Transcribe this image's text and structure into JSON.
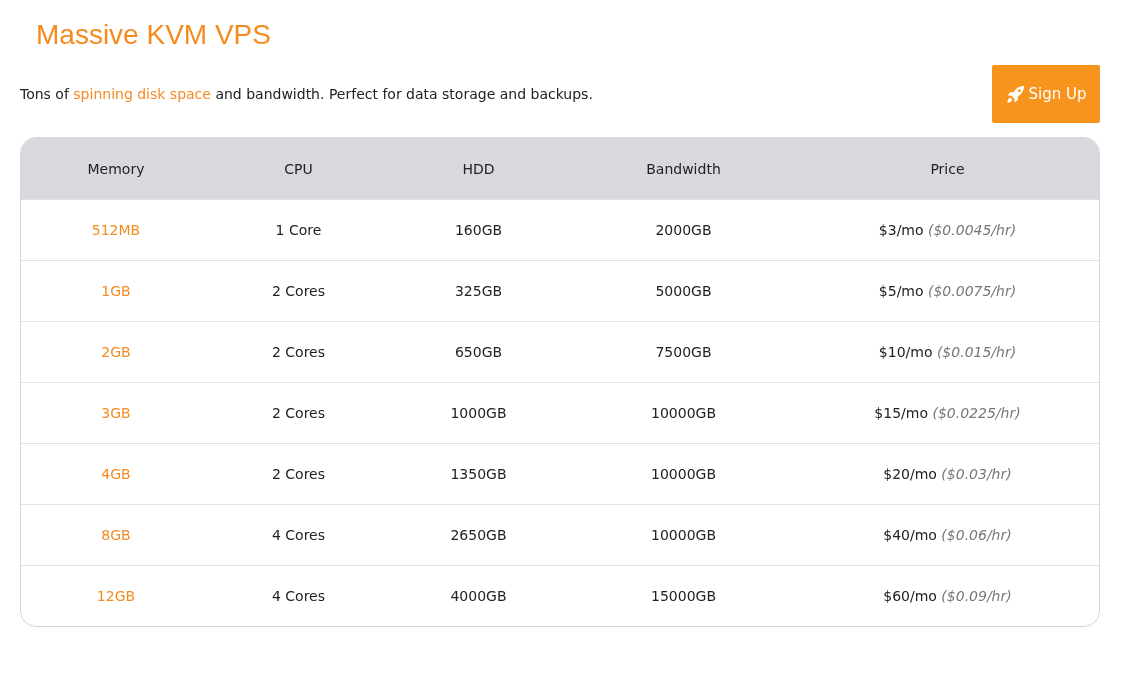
{
  "title": "Massive KVM VPS",
  "description": {
    "before": "Tons of",
    "link": "spinning disk space",
    "after": "and bandwidth. Perfect for data storage and backups."
  },
  "signup_button": {
    "label": "Sign Up"
  },
  "table": {
    "columns": [
      "Memory",
      "CPU",
      "HDD",
      "Bandwidth",
      "Price"
    ],
    "rows": [
      {
        "memory": "512MB",
        "cpu": "1 Core",
        "hdd": "160GB",
        "bandwidth": "2000GB",
        "price": "$3/mo",
        "hourly": "($0.0045/hr)"
      },
      {
        "memory": "1GB",
        "cpu": "2 Cores",
        "hdd": "325GB",
        "bandwidth": "5000GB",
        "price": "$5/mo",
        "hourly": "($0.0075/hr)"
      },
      {
        "memory": "2GB",
        "cpu": "2 Cores",
        "hdd": "650GB",
        "bandwidth": "7500GB",
        "price": "$10/mo",
        "hourly": "($0.015/hr)"
      },
      {
        "memory": "3GB",
        "cpu": "2 Cores",
        "hdd": "1000GB",
        "bandwidth": "10000GB",
        "price": "$15/mo",
        "hourly": "($0.0225/hr)"
      },
      {
        "memory": "4GB",
        "cpu": "2 Cores",
        "hdd": "1350GB",
        "bandwidth": "10000GB",
        "price": "$20/mo",
        "hourly": "($0.03/hr)"
      },
      {
        "memory": "8GB",
        "cpu": "4 Cores",
        "hdd": "2650GB",
        "bandwidth": "10000GB",
        "price": "$40/mo",
        "hourly": "($0.06/hr)"
      },
      {
        "memory": "12GB",
        "cpu": "4 Cores",
        "hdd": "4000GB",
        "bandwidth": "15000GB",
        "price": "$60/mo",
        "hourly": "($0.09/hr)"
      }
    ]
  }
}
